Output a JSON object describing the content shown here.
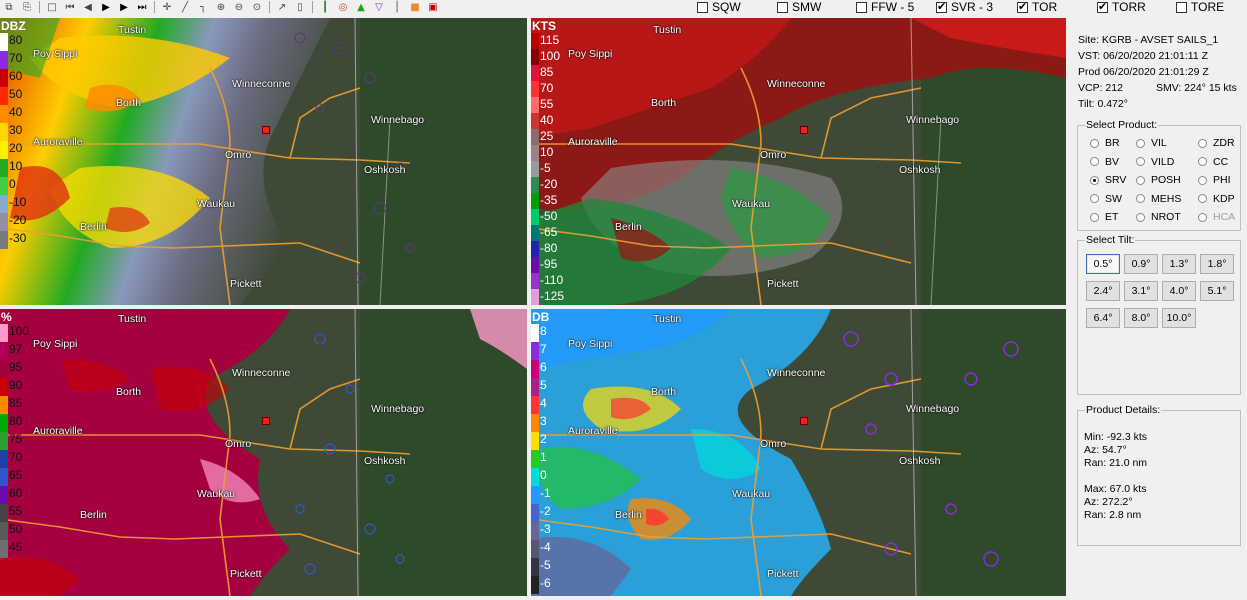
{
  "toolbar": {
    "icons": [
      "copy-icon",
      "paste-icon",
      "stop-icon",
      "skip-back-icon",
      "step-back-icon",
      "play-icon",
      "step-forward-icon",
      "skip-forward-icon",
      "pan-icon",
      "draw-line-icon",
      "measure-icon",
      "zoom-in-icon",
      "zoom-out-icon",
      "zoom-fit-icon",
      "pointer-icon",
      "blank-icon",
      "cross-section-icon",
      "radar-icon",
      "triangle-up-icon",
      "triangle-down-icon",
      "layer-icon",
      "color-icon",
      "stop-record-icon"
    ],
    "checks": [
      {
        "label": "SQW",
        "checked": false
      },
      {
        "label": "SMW",
        "checked": false
      },
      {
        "label": "FFW - 5",
        "checked": false
      },
      {
        "label": "SVR - 3",
        "checked": true
      },
      {
        "label": "TOR",
        "checked": true
      },
      {
        "label": "TORR",
        "checked": true
      },
      {
        "label": "TORE",
        "checked": false
      }
    ]
  },
  "towns": {
    "tustin": "Tustin",
    "poy_sippi": "Poy Sippi",
    "winneconne": "Winneconne",
    "borth": "Borth",
    "winnebago": "Winnebago",
    "auroraville": "Auroraville",
    "omro": "Omro",
    "oshkosh": "Oshkosh",
    "waukau": "Waukau",
    "berlin": "Berlin",
    "pickett": "Pickett"
  },
  "panels": {
    "reflectivity": {
      "units": "DBZ",
      "scale": [
        {
          "label": "80",
          "color": "#ffffff"
        },
        {
          "label": "70",
          "color": "#8a2be2"
        },
        {
          "label": "60",
          "color": "#c80000"
        },
        {
          "label": "50",
          "color": "#ff2a00"
        },
        {
          "label": "40",
          "color": "#ff8c00"
        },
        {
          "label": "30",
          "color": "#ffd700"
        },
        {
          "label": "20",
          "color": "#ffee00"
        },
        {
          "label": "10",
          "color": "#22aa22"
        },
        {
          "label": "0",
          "color": "#44cc44"
        },
        {
          "label": "-10",
          "color": "#88aacc"
        },
        {
          "label": "-20",
          "color": "#9090a0"
        },
        {
          "label": "-30",
          "color": "#7a7a7a"
        }
      ]
    },
    "velocity": {
      "units": "KTS",
      "scale": [
        {
          "label": "115",
          "color": "#b80000"
        },
        {
          "label": "100",
          "color": "#8b0000"
        },
        {
          "label": "85",
          "color": "#dc143c"
        },
        {
          "label": "70",
          "color": "#ff3333"
        },
        {
          "label": "55",
          "color": "#ff6a6a"
        },
        {
          "label": "40",
          "color": "#cc3333"
        },
        {
          "label": "25",
          "color": "#8b6b6b"
        },
        {
          "label": "10",
          "color": "#a08080"
        },
        {
          "label": "-5",
          "color": "#9a9a9a"
        },
        {
          "label": "-20",
          "color": "#2e8b57"
        },
        {
          "label": "-35",
          "color": "#00a000"
        },
        {
          "label": "-50",
          "color": "#00cc66"
        },
        {
          "label": "-65",
          "color": "#007777"
        },
        {
          "label": "-80",
          "color": "#2222aa"
        },
        {
          "label": "-95",
          "color": "#6a0dad"
        },
        {
          "label": "-110",
          "color": "#9932cc"
        },
        {
          "label": "-125",
          "color": "#dda0dd"
        }
      ]
    },
    "correlation": {
      "units": "%",
      "scale": [
        {
          "label": "100",
          "color": "#ff99cc"
        },
        {
          "label": "97",
          "color": "#b0005a"
        },
        {
          "label": "95",
          "color": "#a50040"
        },
        {
          "label": "90",
          "color": "#cc0000"
        },
        {
          "label": "85",
          "color": "#ff8c00"
        },
        {
          "label": "80",
          "color": "#00aa00"
        },
        {
          "label": "75",
          "color": "#2ca02c"
        },
        {
          "label": "70",
          "color": "#1f3faa"
        },
        {
          "label": "65",
          "color": "#3355cc"
        },
        {
          "label": "60",
          "color": "#6a0dad"
        },
        {
          "label": "55",
          "color": "#444444"
        },
        {
          "label": "50",
          "color": "#5a5a5a"
        },
        {
          "label": "45",
          "color": "#6e6e6e"
        }
      ]
    },
    "differential": {
      "units": "DB",
      "scale": [
        {
          "label": "8",
          "color": "#ffffff"
        },
        {
          "label": "7",
          "color": "#8a2be2"
        },
        {
          "label": "6",
          "color": "#cc0077"
        },
        {
          "label": "5",
          "color": "#aa2288"
        },
        {
          "label": "4",
          "color": "#ff3333"
        },
        {
          "label": "3",
          "color": "#ff8800"
        },
        {
          "label": "2",
          "color": "#ffdd00"
        },
        {
          "label": "1",
          "color": "#22cc22"
        },
        {
          "label": "0",
          "color": "#00dddd"
        },
        {
          "label": "-1",
          "color": "#2299ff"
        },
        {
          "label": "-2",
          "color": "#4466cc"
        },
        {
          "label": "-3",
          "color": "#666699"
        },
        {
          "label": "-4",
          "color": "#555577"
        },
        {
          "label": "-5",
          "color": "#333344"
        },
        {
          "label": "-6",
          "color": "#222222"
        }
      ]
    }
  },
  "side": {
    "site": "Site:   KGRB - AVSET SAILS_1",
    "vst": "VST:   06/20/2020  21:01:11 Z",
    "prod": "Prod   06/20/2020  21:01:29 Z",
    "vcp": "VCP:   212",
    "smv": "SMV:  224° 15 kts",
    "tilt": "Tilt:    0.472°",
    "select_product_title": "Select Product:",
    "products": [
      {
        "label": "BR",
        "selected": false,
        "disabled": false
      },
      {
        "label": "VIL",
        "selected": false,
        "disabled": false
      },
      {
        "label": "ZDR",
        "selected": false,
        "disabled": false
      },
      {
        "label": "BV",
        "selected": false,
        "disabled": false
      },
      {
        "label": "VILD",
        "selected": false,
        "disabled": false
      },
      {
        "label": "CC",
        "selected": false,
        "disabled": false
      },
      {
        "label": "SRV",
        "selected": true,
        "disabled": false
      },
      {
        "label": "POSH",
        "selected": false,
        "disabled": false
      },
      {
        "label": "PHI",
        "selected": false,
        "disabled": false
      },
      {
        "label": "SW",
        "selected": false,
        "disabled": false
      },
      {
        "label": "MEHS",
        "selected": false,
        "disabled": false
      },
      {
        "label": "KDP",
        "selected": false,
        "disabled": false
      },
      {
        "label": "ET",
        "selected": false,
        "disabled": false
      },
      {
        "label": "NROT",
        "selected": false,
        "disabled": false
      },
      {
        "label": "HCA",
        "selected": false,
        "disabled": true
      }
    ],
    "select_tilt_title": "Select Tilt:",
    "tilts": [
      "0.5°",
      "0.9°",
      "1.3°",
      "1.8°",
      "2.4°",
      "3.1°",
      "4.0°",
      "5.1°",
      "6.4°",
      "8.0°",
      "10.0°"
    ],
    "active_tilt": "0.5°",
    "details_title": "Product Details:",
    "min_value": "Min:  -92.3 kts",
    "min_az": "Az:   54.7°",
    "min_ran": "Ran:  21.0 nm",
    "max_value": "Max:  67.0 kts",
    "max_az": "Az:   272.2°",
    "max_ran": "Ran:  2.8 nm"
  }
}
